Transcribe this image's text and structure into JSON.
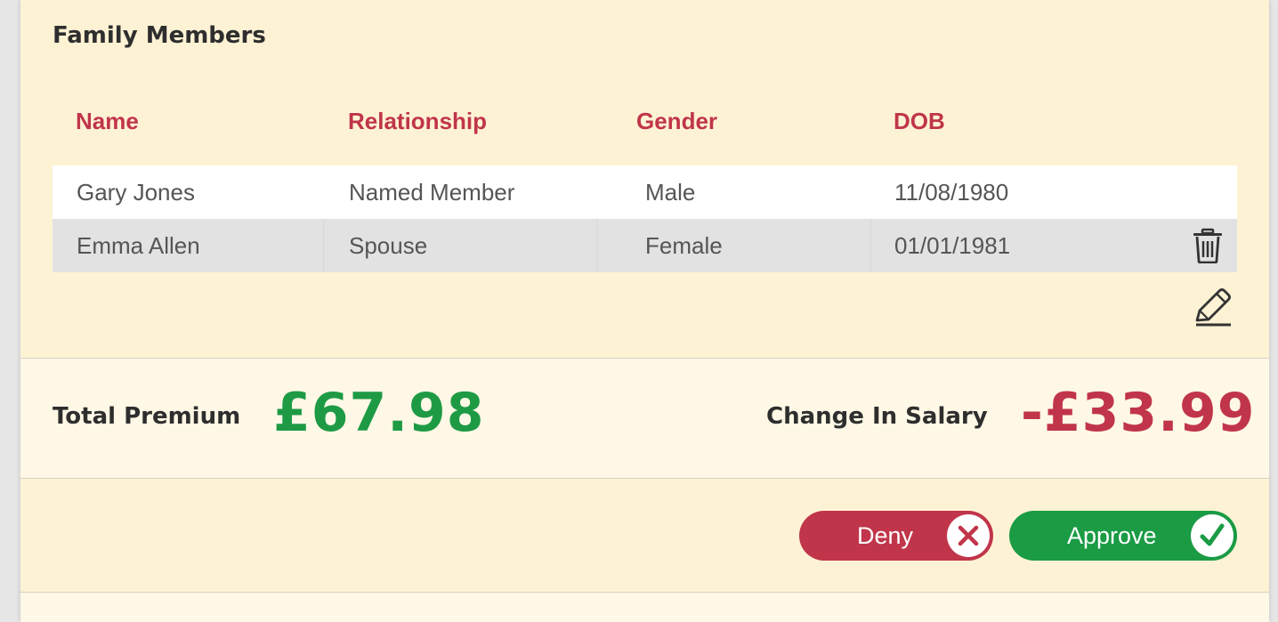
{
  "section": {
    "title": "Family Members"
  },
  "table": {
    "headers": [
      "Name",
      "Relationship",
      "Gender",
      "DOB"
    ],
    "rows": [
      {
        "name": "Gary Jones",
        "relationship": "Named Member",
        "gender": "Male",
        "dob": "11/08/1980"
      },
      {
        "name": "Emma Allen",
        "relationship": "Spouse",
        "gender": "Female",
        "dob": "01/01/1981"
      }
    ]
  },
  "icons": {
    "delete": "trash-icon",
    "edit": "pencil-icon",
    "deny": "x-icon",
    "approve": "check-icon"
  },
  "summary": {
    "total_premium_label": "Total Premium",
    "total_premium_value": "£67.98",
    "change_salary_label": "Change In Salary",
    "change_salary_value": "-£33.99"
  },
  "actions": {
    "deny_label": "Deny",
    "approve_label": "Approve"
  },
  "colors": {
    "panel": "#fef2d5",
    "header_red": "#c0354a",
    "approve_green": "#1a9b44",
    "positive_green": "#1e9a45",
    "deny_red": "#c0354a"
  }
}
